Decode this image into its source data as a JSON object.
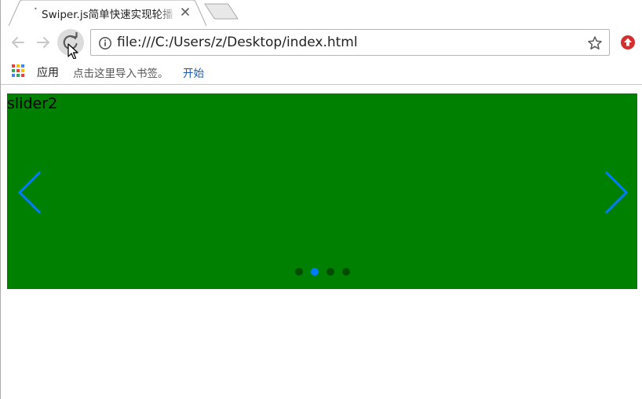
{
  "browser": {
    "tab": {
      "title": "Swiper.js简单快速实现轮播"
    },
    "omnibox": {
      "url": "file:///C:/Users/z/Desktop/index.html"
    },
    "bookmarks": {
      "apps_label": "应用",
      "hint": "点击这里导入书签。",
      "start_link": "开始"
    },
    "colors": {
      "icon_gray": "#9a9a9a",
      "extension_red": "#d32f2f"
    }
  },
  "page": {
    "slide": {
      "label": "slider2",
      "background": "#008000"
    },
    "navigation": {
      "prev_icon": "chevron-left-icon",
      "next_icon": "chevron-right-icon",
      "color": "#007aff"
    },
    "pagination": {
      "count": 4,
      "active_index": 1,
      "active_color": "#007aff",
      "inactive_color": "#004d00"
    }
  }
}
